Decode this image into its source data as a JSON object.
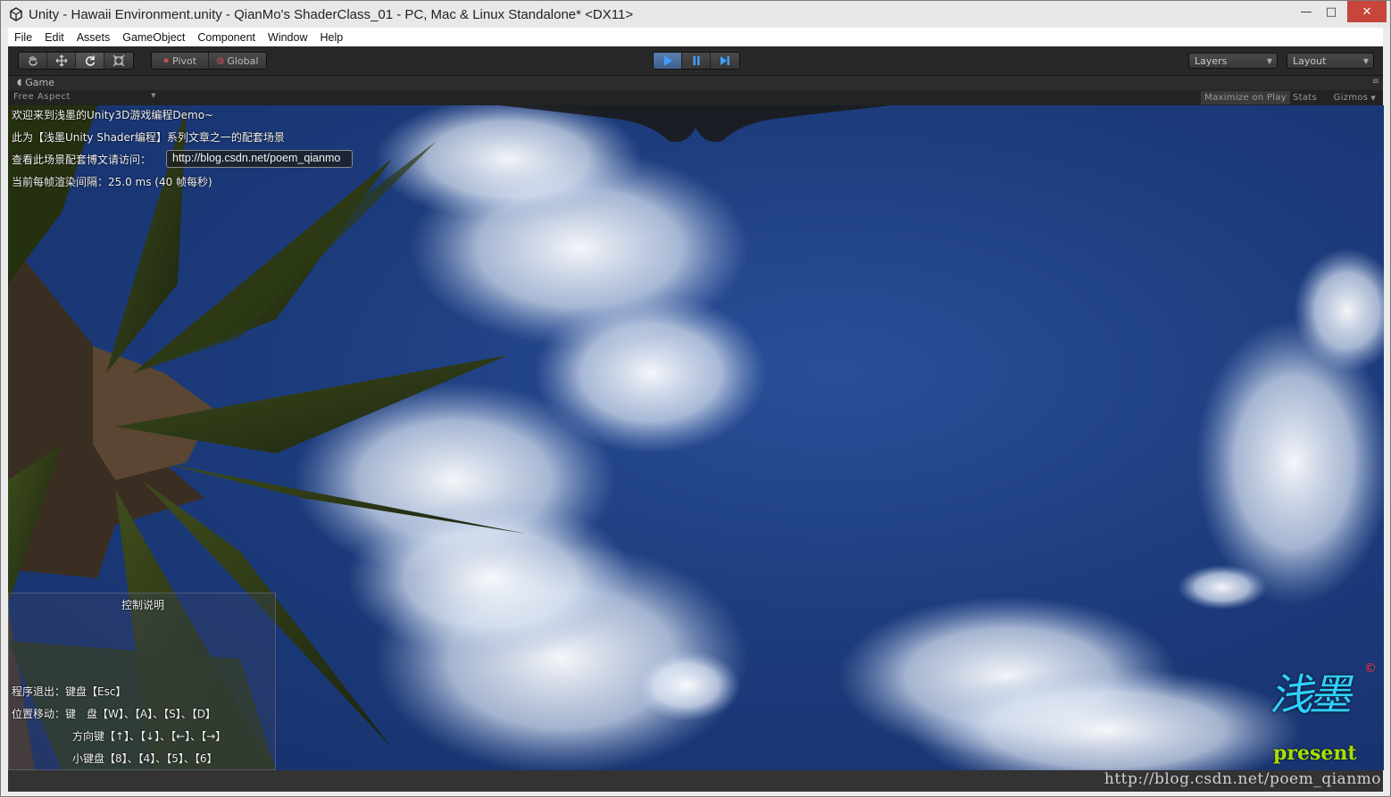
{
  "window": {
    "title": "Unity - Hawaii Environment.unity - QianMo's ShaderClass_01 - PC, Mac & Linux Standalone* <DX11>",
    "controls": {
      "minimize": "—",
      "maximize": "□",
      "close": "✕"
    }
  },
  "menu": [
    "File",
    "Edit",
    "Assets",
    "GameObject",
    "Component",
    "Window",
    "Help"
  ],
  "toolbar": {
    "tools": [
      "hand-icon",
      "move-icon",
      "rotate-icon",
      "scale-icon"
    ],
    "pivot_label": "Pivot",
    "global_label": "Global",
    "playback": [
      "play-icon",
      "pause-icon",
      "step-icon"
    ],
    "layers_label": "Layers",
    "layout_label": "Layout"
  },
  "game_view": {
    "tab_label": "Game",
    "aspect": "Free Aspect",
    "maximize_label": "Maximize on Play",
    "stats_label": "Stats",
    "gizmos_label": "Gizmos"
  },
  "overlay": {
    "welcome": "欢迎来到浅墨的Unity3D游戏编程Demo~",
    "series": "此为【浅墨Unity Shader编程】系列文章之一的配套场景",
    "visit_label": "查看此场景配套博文请访问：",
    "url": "http://blog.csdn.net/poem_qianmo",
    "frame_time": "当前每帧渲染间隔：25.0 ms (40 帧每秒)"
  },
  "controls": {
    "title": "控制说明",
    "lines": [
      "程序退出：键盘【Esc】",
      "位置移动：键　盘【W】、【A】、【S】、【D】",
      "方向键【↑】、【↓】、【←】、【→】",
      "小键盘【8】、【4】、【5】、【6】"
    ]
  },
  "logo": {
    "glyph": "浅墨",
    "present": "present",
    "copyright": "©"
  },
  "watermark": "http://blog.csdn.net/poem_qianmo",
  "colors": {
    "toolbar_bg": "#282828",
    "play_active": "#4a6fa0",
    "sky": "#1d3c7d",
    "logo_cyan": "#2fd0ff",
    "present_green": "#a9e000"
  }
}
